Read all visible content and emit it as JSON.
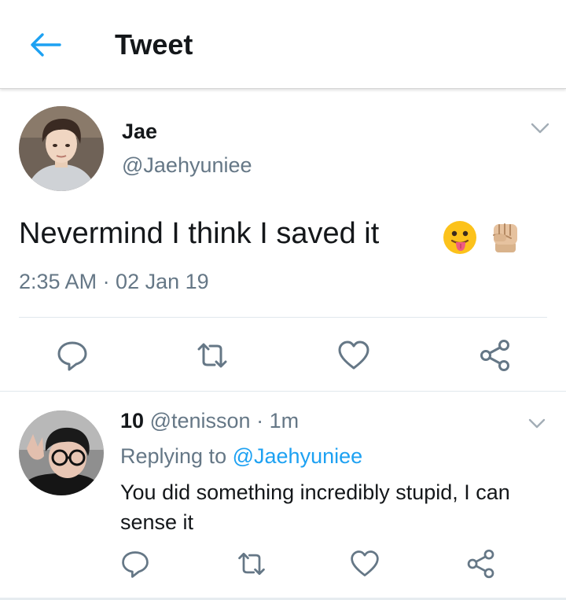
{
  "header": {
    "title": "Tweet"
  },
  "tweet": {
    "author_name": "Jae",
    "author_handle": "@Jaehyuniee",
    "text": "Nevermind I think I saved it",
    "timestamp": "2:35 AM · 02 Jan 19"
  },
  "reply": {
    "author_name": "10",
    "author_handle": "@tenisson",
    "separator": "·",
    "time": "1m",
    "replying_prefix": "Replying to",
    "replying_to": "@Jaehyuniee",
    "text": "You did something incredibly stupid, I can sense it"
  },
  "colors": {
    "accent": "#1da1f2",
    "muted_text": "#657786",
    "icon_gray": "#657786"
  },
  "icons": {
    "back": "arrow-left-icon",
    "menu": "chevron-down-icon",
    "reply": "reply-icon",
    "retweet": "retweet-icon",
    "like": "heart-icon",
    "share": "share-icon",
    "emoji_1": "tongue-out-emoji",
    "emoji_2": "raised-fist-emoji"
  }
}
